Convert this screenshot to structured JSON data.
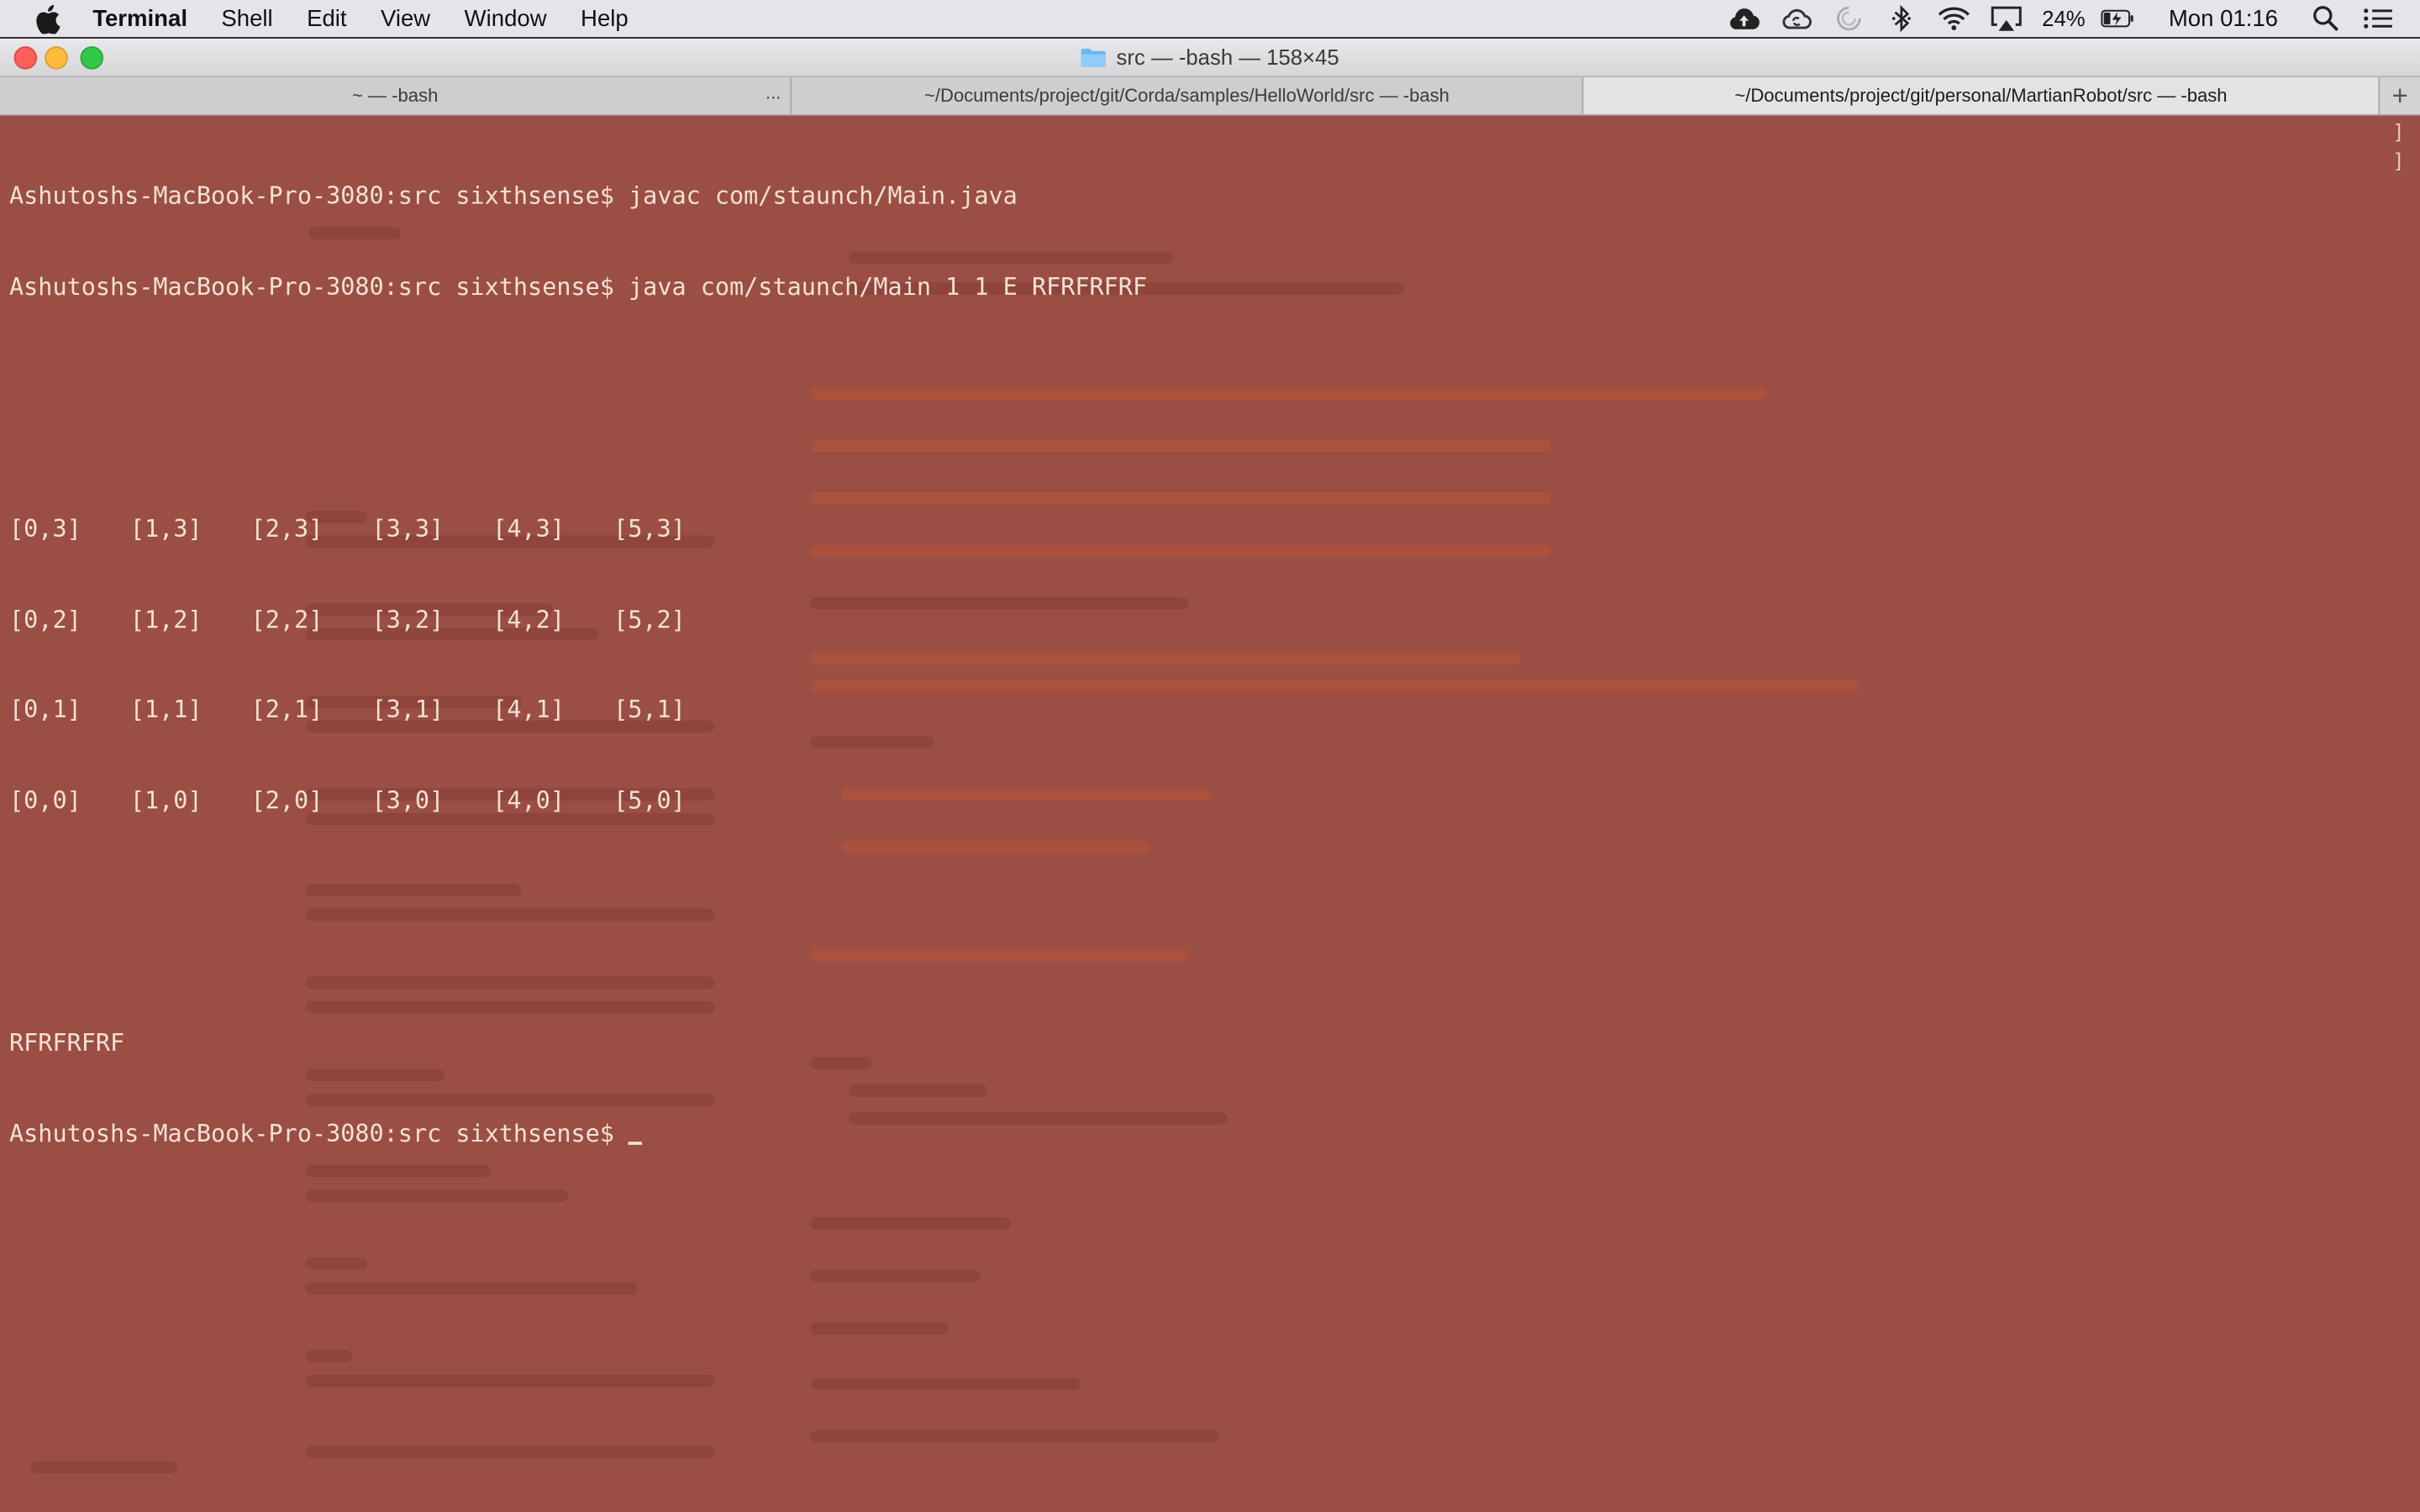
{
  "menubar": {
    "app_name": "Terminal",
    "items": [
      "Shell",
      "Edit",
      "View",
      "Window",
      "Help"
    ],
    "battery_percent": "24%",
    "clock": "Mon 01:16",
    "icons": [
      "apple-icon",
      "cloud-upload-icon",
      "creative-cloud-icon",
      "sync-spinner-icon",
      "bluetooth-icon",
      "wifi-icon",
      "airplay-icon",
      "battery-charging-icon",
      "spotlight-search-icon",
      "notification-center-icon"
    ]
  },
  "window": {
    "title": "src — -bash — 158×45"
  },
  "tabs": [
    {
      "label": "~ — -bash",
      "active": false,
      "has_menu": true,
      "menu_glyph": "..."
    },
    {
      "label": "~/Documents/project/git/Corda/samples/HelloWorld/src — -bash",
      "active": false
    },
    {
      "label": "~/Documents/project/git/personal/MartianRobot/src — -bash",
      "active": true
    }
  ],
  "new_tab_glyph": "+",
  "terminal": {
    "background": "#9b4e44",
    "foreground": "#f2e2d3",
    "lines": [
      "Ashutoshs-MacBook-Pro-3080:src sixthsense$ javac com/staunch/Main.java",
      "Ashutoshs-MacBook-Pro-3080:src sixthsense$ java com/staunch/Main 1 1 E RFRFRFRF"
    ],
    "grid": [
      [
        "[0,3]",
        "[1,3]",
        "[2,3]",
        "[3,3]",
        "[4,3]",
        "[5,3]"
      ],
      [
        "[0,2]",
        "[1,2]",
        "[2,2]",
        "[3,2]",
        "[4,2]",
        "[5,2]"
      ],
      [
        "[0,1]",
        "[1,1]",
        "[2,1]",
        "[3,1]",
        "[4,1]",
        "[5,1]"
      ],
      [
        "[0,0]",
        "[1,0]",
        "[2,0]",
        "[3,0]",
        "[4,0]",
        "[5,0]"
      ]
    ],
    "output": "RFRFRFRF",
    "prompt": "Ashutoshs-MacBook-Pro-3080:src sixthsense$ ",
    "scroll_markers": [
      "]",
      "]"
    ]
  }
}
